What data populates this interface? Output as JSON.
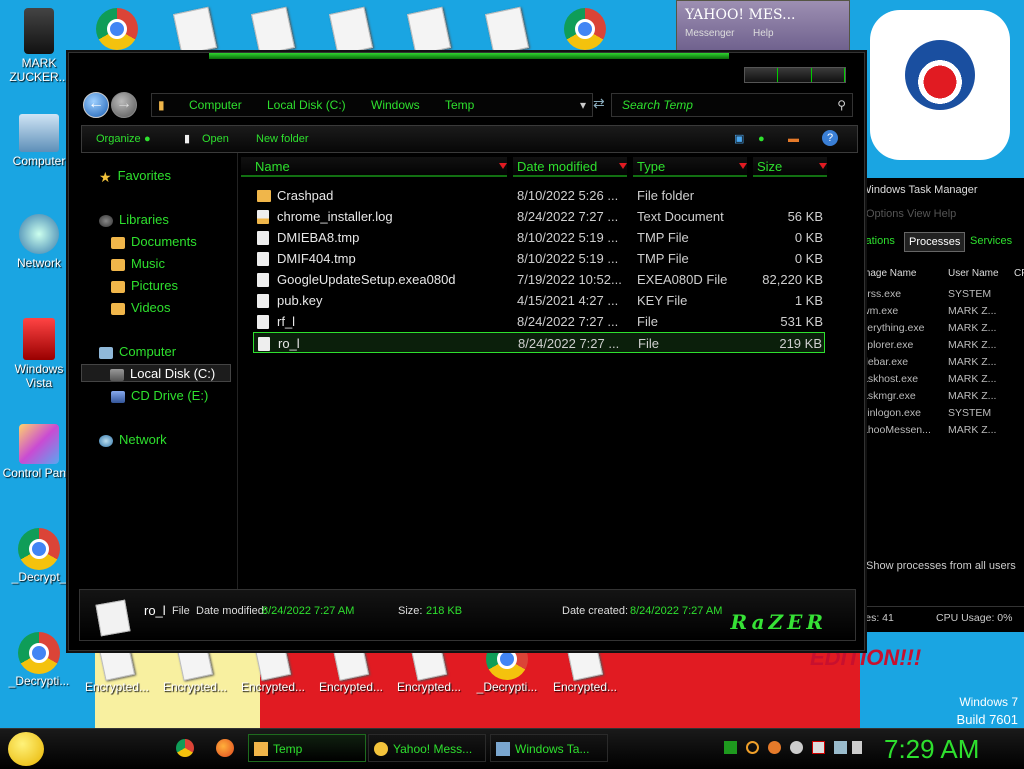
{
  "desktop": {
    "icons": [
      {
        "label": "MARK ZUCKER..."
      },
      {
        "label": "Computer"
      },
      {
        "label": "Network"
      },
      {
        "label": "Windows Vista"
      },
      {
        "label": "Control Panel"
      },
      {
        "label": "_Decrypt_"
      },
      {
        "label": "_Decrypti..."
      }
    ],
    "bottom_icons": [
      "Encrypted...",
      "Encrypted...",
      "Encrypted...",
      "Encrypted...",
      "Encrypted...",
      "_Decrypti...",
      "Encrypted..."
    ],
    "edition_text": "EDITION!!!",
    "os_label": "Windows 7",
    "build_label": "Build 7601"
  },
  "explorer": {
    "breadcrumb": [
      "Computer",
      "Local Disk (C:)",
      "Windows",
      "Temp"
    ],
    "search_placeholder": "Search Temp",
    "toolbar": {
      "organize": "Organize",
      "open": "Open",
      "new_folder": "New folder"
    },
    "nav": {
      "favorites": "Favorites",
      "libraries": "Libraries",
      "library_items": [
        "Documents",
        "Music",
        "Pictures",
        "Videos"
      ],
      "computer": "Computer",
      "drives": [
        "Local Disk (C:)",
        "CD Drive (E:)"
      ],
      "network": "Network"
    },
    "columns": [
      "Name",
      "Date modified",
      "Type",
      "Size"
    ],
    "files": [
      {
        "name": "Crashpad",
        "date": "8/10/2022 5:26 ...",
        "type": "File folder",
        "size": ""
      },
      {
        "name": "chrome_installer.log",
        "date": "8/24/2022 7:27 ...",
        "type": "Text Document",
        "size": "56 KB"
      },
      {
        "name": "DMIEBA8.tmp",
        "date": "8/10/2022 5:19 ...",
        "type": "TMP File",
        "size": "0 KB"
      },
      {
        "name": "DMIF404.tmp",
        "date": "8/10/2022 5:19 ...",
        "type": "TMP File",
        "size": "0 KB"
      },
      {
        "name": "GoogleUpdateSetup.exea080d",
        "date": "7/19/2022 10:52...",
        "type": "EXEA080D File",
        "size": "82,220 KB"
      },
      {
        "name": "pub.key",
        "date": "4/15/2021 4:27 ...",
        "type": "KEY File",
        "size": "1 KB"
      },
      {
        "name": "rf_l",
        "date": "8/24/2022 7:27 ...",
        "type": "File",
        "size": "531 KB"
      },
      {
        "name": "ro_l",
        "date": "8/24/2022 7:27 ...",
        "type": "File",
        "size": "219 KB"
      }
    ],
    "details": {
      "name": "ro_l",
      "kind": "File",
      "date_modified_label": "Date modified:",
      "date_modified": "8/24/2022 7:27 AM",
      "size_label": "Size:",
      "size": "218 KB",
      "date_created_label": "Date created:",
      "date_created": "8/24/2022 7:27 AM",
      "brand": "RaZER"
    }
  },
  "yahoo": {
    "title": "YAHOO! MES...",
    "subtitle": "Messenger",
    "help": "Help"
  },
  "taskmgr": {
    "title": "Windows Task Manager",
    "menu": "Options   View   Help",
    "tabs": [
      "cations",
      "Processes",
      "Services"
    ],
    "columns": [
      "mage Name",
      "User Name",
      "CP"
    ],
    "processes": [
      {
        "name": "srss.exe",
        "user": "SYSTEM"
      },
      {
        "name": "wm.exe",
        "user": "MARK Z..."
      },
      {
        "name": "verything.exe",
        "user": "MARK Z..."
      },
      {
        "name": "xplorer.exe",
        "user": "MARK Z..."
      },
      {
        "name": "debar.exe",
        "user": "MARK Z..."
      },
      {
        "name": "askhost.exe",
        "user": "MARK Z..."
      },
      {
        "name": "askmgr.exe",
        "user": "MARK Z..."
      },
      {
        "name": "vinlogon.exe",
        "user": "SYSTEM"
      },
      {
        "name": "ahooMessen...",
        "user": "MARK Z..."
      }
    ],
    "show_all": "Show processes from all users",
    "processes_count": "ses: 41",
    "cpu_usage": "CPU Usage: 0%"
  },
  "taskbar": {
    "buttons": [
      "Temp",
      "Yahoo! Mess...",
      "Windows Ta..."
    ],
    "clock": "7:29 AM"
  },
  "colors": {
    "accent": "#2ee02e",
    "background": "#1aa5e2"
  }
}
